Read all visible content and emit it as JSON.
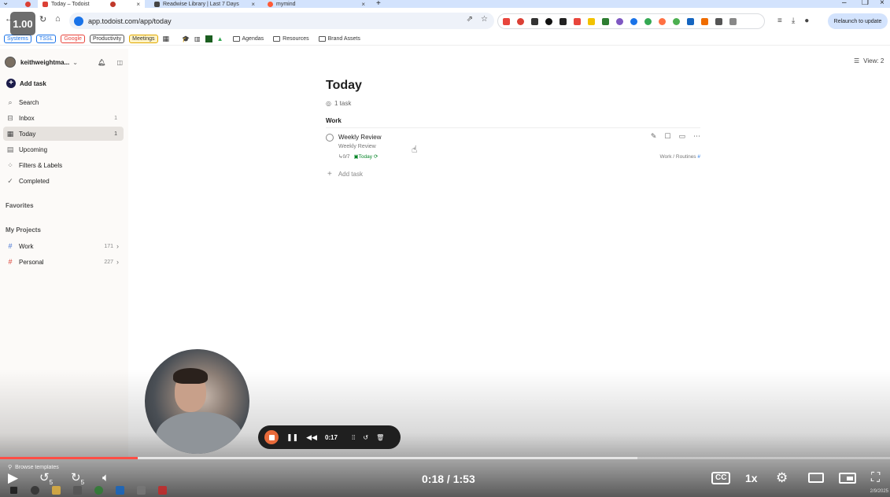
{
  "browser": {
    "tabs": [
      {
        "title": "Today – Todoist",
        "active": true
      },
      {
        "title": "Readwise Library | Last 7 Days",
        "active": false
      },
      {
        "title": "mymind",
        "active": false
      }
    ],
    "new_tab_glyph": "+",
    "url": "app.todoist.com/app/today",
    "relaunch_label": "Relaunch to update",
    "playback_speed": "1.00",
    "bookmarks": {
      "chips": [
        {
          "label": "Systems",
          "color": "#1a73e8"
        },
        {
          "label": "TSSL",
          "color": "#1a73e8"
        },
        {
          "label": "Google",
          "color": "#e8453c"
        },
        {
          "label": "Productivity",
          "color": "#555555"
        },
        {
          "label": "Meetings",
          "color": "#e0a800"
        }
      ],
      "folders": [
        "Agendas",
        "Resources",
        "Brand Assets"
      ]
    }
  },
  "sidebar": {
    "username": "keithweightma...",
    "add_task": "Add task",
    "items": [
      {
        "label": "Search",
        "icon": "search-icon",
        "count": ""
      },
      {
        "label": "Inbox",
        "icon": "inbox-icon",
        "count": "1"
      },
      {
        "label": "Today",
        "icon": "calendar-icon",
        "count": "1",
        "active": true
      },
      {
        "label": "Upcoming",
        "icon": "calendar-grid-icon",
        "count": ""
      },
      {
        "label": "Filters & Labels",
        "icon": "grid-icon",
        "count": ""
      },
      {
        "label": "Completed",
        "icon": "check-circle-icon",
        "count": ""
      }
    ],
    "favorites_heading": "Favorites",
    "projects_heading": "My Projects",
    "projects": [
      {
        "label": "Work",
        "count": "171",
        "color": "#4573d2"
      },
      {
        "label": "Personal",
        "count": "227",
        "color": "#db4035"
      }
    ]
  },
  "main": {
    "view_label": "View: 2",
    "title": "Today",
    "task_count": "1 task",
    "section": "Work",
    "tasks": [
      {
        "title": "Weekly Review",
        "description": "Weekly Review",
        "subtasks": "0/7",
        "due": "Today",
        "project": "Work / Routines"
      }
    ],
    "add_task": "Add task"
  },
  "recorder": {
    "time": "0:17"
  },
  "video": {
    "browse_templates": "Browse templates",
    "elapsed": "0:18",
    "separator": " / ",
    "duration": "1:53",
    "progress": 0.155,
    "buffered": 0.716,
    "speed_label": "1x",
    "cc_label": "CC",
    "skip_back": "5",
    "skip_forward": "5",
    "corner_date": "2/9/2025"
  }
}
